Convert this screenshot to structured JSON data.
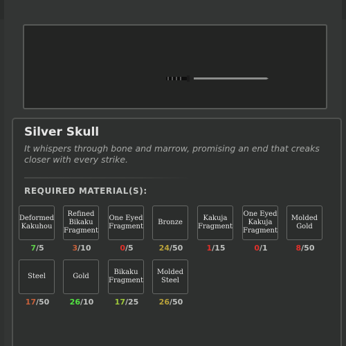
{
  "item": {
    "name": "Silver Skull",
    "description": "It whispers through bone and marrow, promising an end that creaks closer with every strike."
  },
  "required_label": "REQUIRED MATERIAL(S):",
  "materials": [
    {
      "name": "Deformed Kakuhou",
      "have": "7",
      "need": "/5",
      "have_color": "#5ed049"
    },
    {
      "name": "Refined Bikaku Fragment",
      "have": "3",
      "need": "/10",
      "have_color": "#c7603a"
    },
    {
      "name": "One Eyed Fragment",
      "have": "0",
      "need": "/5",
      "have_color": "#e0302a"
    },
    {
      "name": "Bronze",
      "have": "24",
      "need": "/50",
      "have_color": "#b9a23a"
    },
    {
      "name": "Kakuja Fragment",
      "have": "1",
      "need": "/15",
      "have_color": "#e0302a"
    },
    {
      "name": "One Eyed Kakuja Fragment",
      "have": "0",
      "need": "/1",
      "have_color": "#e0302a"
    },
    {
      "name": "Molded Gold",
      "have": "8",
      "need": "/50",
      "have_color": "#e0302a"
    },
    {
      "name": "Steel",
      "have": "17",
      "need": "/50",
      "have_color": "#c7603a"
    },
    {
      "name": "Gold",
      "have": "26",
      "need": "/10",
      "have_color": "#53e343"
    },
    {
      "name": "Bikaku Fragment",
      "have": "17",
      "need": "/25",
      "have_color": "#9ec83a"
    },
    {
      "name": "Molded Steel",
      "have": "26",
      "need": "/50",
      "have_color": "#b9a23a"
    }
  ]
}
